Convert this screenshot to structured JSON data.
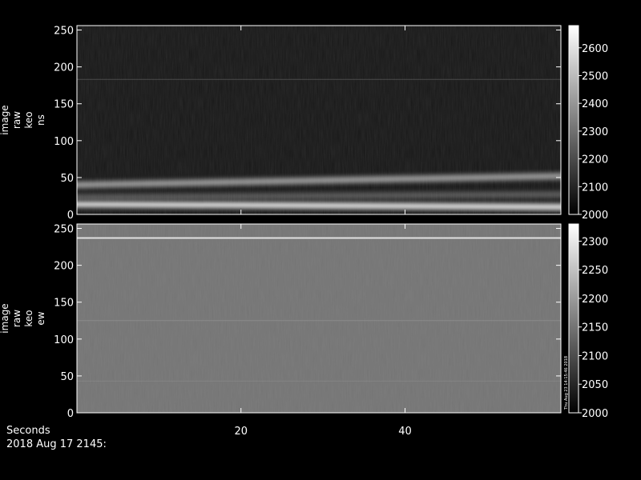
{
  "footer": {
    "xlabel": "Seconds",
    "timestamp": "2018 Aug 17 2145:"
  },
  "colors": {
    "background": "#000000",
    "axes": "#ffffff"
  },
  "chart_data": [
    {
      "type": "heatmap",
      "ylabel": [
        "image",
        "raw",
        "keo",
        "ns"
      ],
      "yticks": [
        0,
        50,
        100,
        150,
        200,
        250
      ],
      "ylim": [
        0,
        256
      ],
      "xticks": [
        20,
        40
      ],
      "xlim": [
        0,
        59
      ],
      "colorbar": {
        "ticks": [
          2000,
          2100,
          2200,
          2300,
          2400,
          2500,
          2600
        ],
        "range": [
          2000,
          2680
        ],
        "colormap": "grayscale"
      },
      "grid": false,
      "features": [
        {
          "kind": "band",
          "y_start": 14,
          "y_end": 10,
          "value": 2650
        },
        {
          "kind": "band",
          "y_start": 40,
          "y_end": 52,
          "value": 2450
        },
        {
          "kind": "band",
          "y_start": 23,
          "y_end": 27,
          "value": 2250
        },
        {
          "kind": "line",
          "y": 183,
          "value": 2200
        },
        {
          "kind": "background",
          "value": 2060
        }
      ]
    },
    {
      "type": "heatmap",
      "ylabel": [
        "image",
        "raw",
        "keo",
        "ew"
      ],
      "yticks": [
        0,
        50,
        100,
        150,
        200,
        250
      ],
      "ylim": [
        0,
        256
      ],
      "xticks": [
        20,
        40
      ],
      "xlim": [
        0,
        59
      ],
      "colorbar": {
        "ticks": [
          2000,
          2050,
          2100,
          2150,
          2200,
          2250,
          2300
        ],
        "range": [
          2000,
          2330
        ],
        "colormap": "grayscale"
      },
      "colorbar_note": "Thu Aug 23 14:15:46 2018",
      "grid": false,
      "features": [
        {
          "kind": "line",
          "y": 237,
          "value": 2320
        },
        {
          "kind": "line",
          "y": 125,
          "value": 2180
        },
        {
          "kind": "line",
          "y": 43,
          "value": 2170
        },
        {
          "kind": "background",
          "value": 2150
        }
      ]
    }
  ]
}
